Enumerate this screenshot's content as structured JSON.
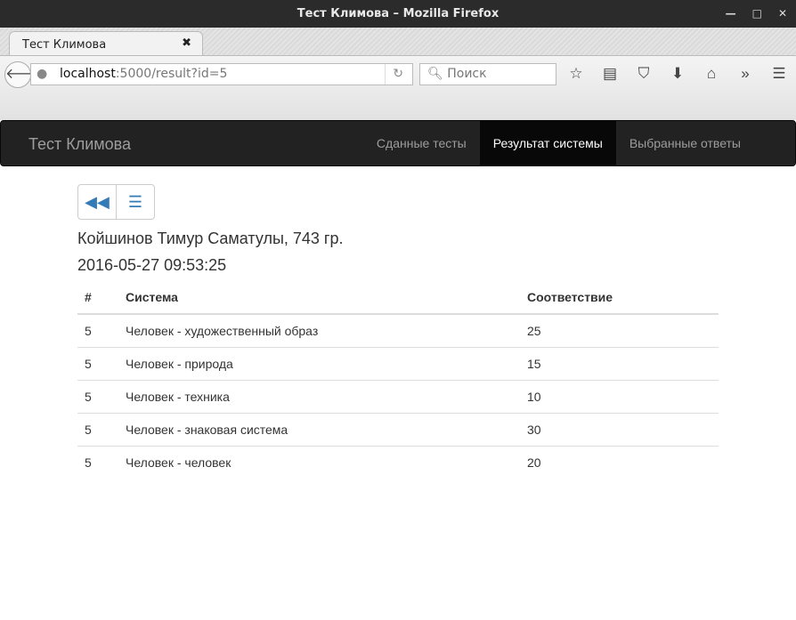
{
  "window": {
    "title": "Тест Климова – Mozilla Firefox"
  },
  "browser": {
    "tab_title": "Тест Климова",
    "url_host": "localhost",
    "url_rest": ":5000/result?id=5",
    "search_placeholder": "Поиск"
  },
  "navbar": {
    "brand": "Тест Климова",
    "links": [
      {
        "label": "Сданные тесты"
      },
      {
        "label": "Результат системы",
        "active": true
      },
      {
        "label": "Выбранные ответы"
      }
    ]
  },
  "student": {
    "name": "Койшинов Тимур Саматулы, 743 гр.",
    "datetime": "2016-05-27 09:53:25"
  },
  "table": {
    "headers": [
      "#",
      "Система",
      "Соответствие"
    ],
    "rows": [
      [
        "5",
        "Человек - художественный образ",
        "25"
      ],
      [
        "5",
        "Человек - природа",
        "15"
      ],
      [
        "5",
        "Человек - техника",
        "10"
      ],
      [
        "5",
        "Человек - знаковая система",
        "30"
      ],
      [
        "5",
        "Человек - человек",
        "20"
      ]
    ]
  }
}
